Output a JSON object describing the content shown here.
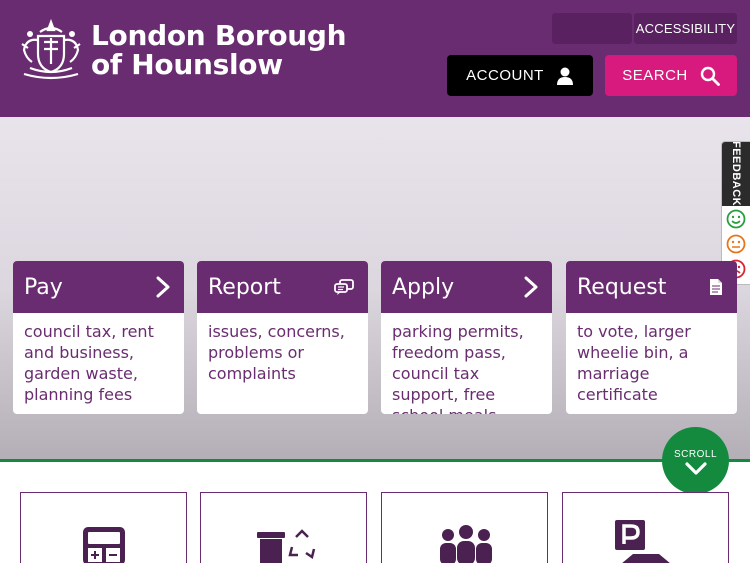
{
  "header": {
    "brand_line1": "London Borough",
    "brand_line2": "of Hounslow",
    "accessibility_label": "ACCESSIBILITY",
    "account_label": "ACCOUNT",
    "search_label": "SEARCH"
  },
  "feedback": {
    "label": "FEEDBACK",
    "faces": [
      "happy-face-icon",
      "neutral-face-icon",
      "sad-face-icon"
    ]
  },
  "cards": [
    {
      "title": "Pay",
      "icon": "chevron-right-icon",
      "description": "council tax, rent and business, garden waste, planning fees"
    },
    {
      "title": "Report",
      "icon": "chat-bubbles-icon",
      "description": "issues, concerns, problems or complaints"
    },
    {
      "title": "Apply",
      "icon": "chevron-right-icon",
      "description": "parking permits, freedom pass, council tax support, free school meals"
    },
    {
      "title": "Request",
      "icon": "document-icon",
      "description": "to vote, larger wheelie bin, a marriage certificate"
    }
  ],
  "scroll": {
    "label": "SCROLL"
  },
  "tiles": [
    {
      "icon": "calculator-icon"
    },
    {
      "icon": "bin-recycling-icon"
    },
    {
      "icon": "people-icon"
    },
    {
      "icon": "parking-icon"
    }
  ],
  "colors": {
    "brand_purple": "#6a2c70",
    "search_pink": "#d81a7f",
    "scroll_green": "#138a3e"
  }
}
